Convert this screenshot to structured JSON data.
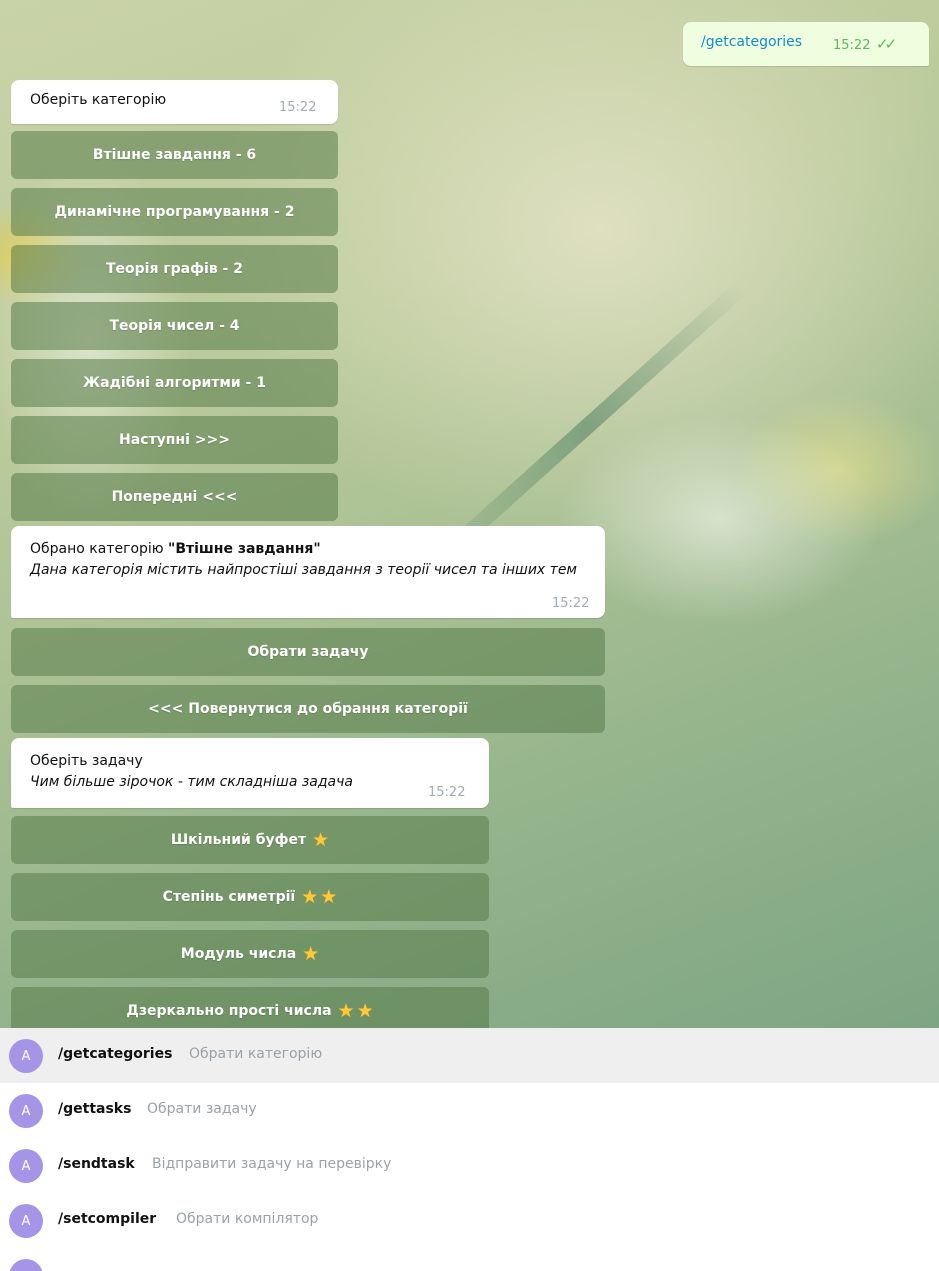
{
  "outgoing": {
    "text": "/getcategories",
    "time": "15:22",
    "status_icon": "double-check-icon"
  },
  "msg_choose_category": {
    "text": "Оберіть категорію",
    "time": "15:22"
  },
  "category_buttons": [
    "Втішне завдання - 6",
    "Динамічне програмування - 2",
    "Теорія графів - 2",
    "Теорія чисел - 4",
    "Жадібні алгоритми - 1",
    "Наступні >>>",
    "Попередні <<<"
  ],
  "msg_selected": {
    "prefix": "Обрано категорію ",
    "category": "\"Втішне завдання\"",
    "description": "Дана категорія містить найпростіші завдання з теорії чисел та інших тем",
    "time": "15:22"
  },
  "action_buttons": [
    "Обрати задачу",
    "<<< Повернутися до обрання категорії"
  ],
  "msg_choose_task": {
    "title": "Оберіть задачу",
    "hint": "Чим більше зірочок - тим складніша задача",
    "time": "15:22"
  },
  "task_buttons": [
    {
      "label": "Шкільний буфет",
      "stars": 1
    },
    {
      "label": "Степінь симетрії",
      "stars": 2
    },
    {
      "label": "Модуль числа",
      "stars": 1
    },
    {
      "label": "Дзеркально прості числа",
      "stars": 2
    }
  ],
  "commands": [
    {
      "avatar": "A",
      "name": "/getcategories",
      "description": "Обрати категорію",
      "selected": true
    },
    {
      "avatar": "A",
      "name": "/gettasks",
      "description": "Обрати задачу",
      "selected": false
    },
    {
      "avatar": "A",
      "name": "/sendtask",
      "description": "Відправити задачу на перевірку",
      "selected": false
    },
    {
      "avatar": "A",
      "name": "/setcompiler",
      "description": "Обрати компілятор",
      "selected": false
    }
  ],
  "colors": {
    "accent_link": "#168acd",
    "sent_bubble": "#eefedf",
    "check": "#5fb660",
    "avatar": "#a695e7",
    "star": "#ffc93c"
  }
}
